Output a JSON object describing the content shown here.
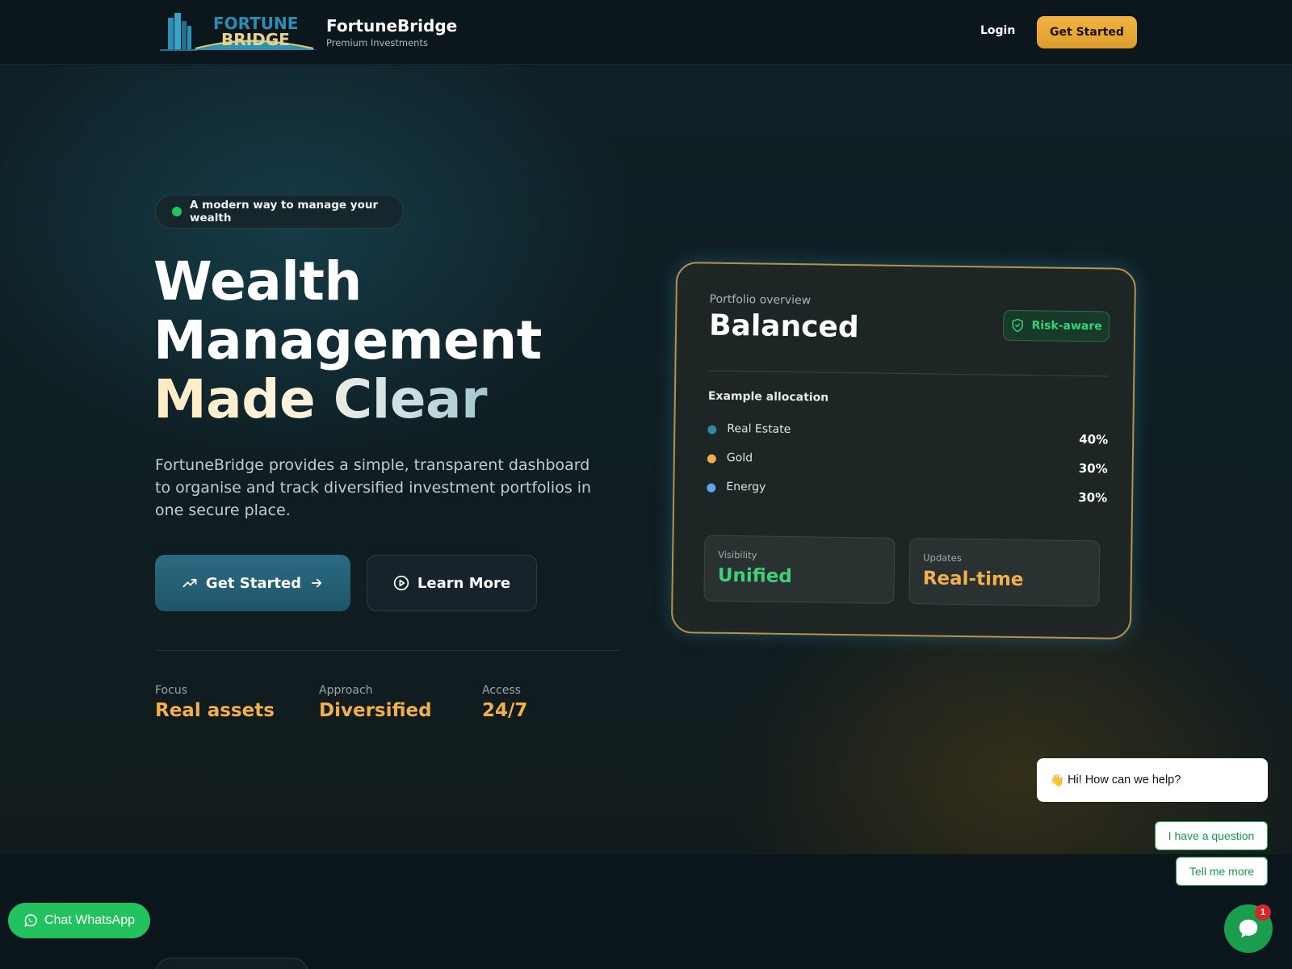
{
  "header": {
    "logo_text_line1": "FORTUNE",
    "logo_text_line2": "BRIDGE",
    "brand_name": "FortuneBridge",
    "brand_tagline": "Premium Investments",
    "login_label": "Login",
    "cta_label": "Get Started"
  },
  "hero": {
    "pill_label": "A modern way to manage your wealth",
    "title_line1": "Wealth",
    "title_line2": "Management",
    "title_line3": "Made Clear",
    "description": "FortuneBridge provides a simple, transparent dashboard to organise and track diversified investment portfolios in one secure place.",
    "primary_button": "Get Started",
    "secondary_button": "Learn More",
    "stats": [
      {
        "label": "Focus",
        "value": "Real assets"
      },
      {
        "label": "Approach",
        "value": "Diversified"
      },
      {
        "label": "Access",
        "value": "24/7"
      }
    ]
  },
  "card": {
    "subtitle": "Portfolio overview",
    "title": "Balanced",
    "badge": "Risk-aware",
    "allocation_title": "Example allocation",
    "allocations": [
      {
        "name": "Real Estate",
        "percent": "40%",
        "color": "#2f8aa3"
      },
      {
        "name": "Gold",
        "percent": "30%",
        "color": "#f1b04b"
      },
      {
        "name": "Energy",
        "percent": "30%",
        "color": "#5fa4ee"
      }
    ],
    "metrics": [
      {
        "label": "Visibility",
        "value": "Unified",
        "color": "#3fd07a"
      },
      {
        "label": "Updates",
        "value": "Real-time",
        "color": "#f1b04b"
      }
    ]
  },
  "chat": {
    "whatsapp_label": "Chat WhatsApp",
    "bubble_text": "Hi! How can we help?",
    "quick_replies": [
      "I have a question",
      "Tell me more"
    ],
    "notification_count": "1"
  },
  "colors": {
    "accent_gold": "#f1b04b",
    "accent_teal": "#2b6b82",
    "success_green": "#22c55e"
  }
}
